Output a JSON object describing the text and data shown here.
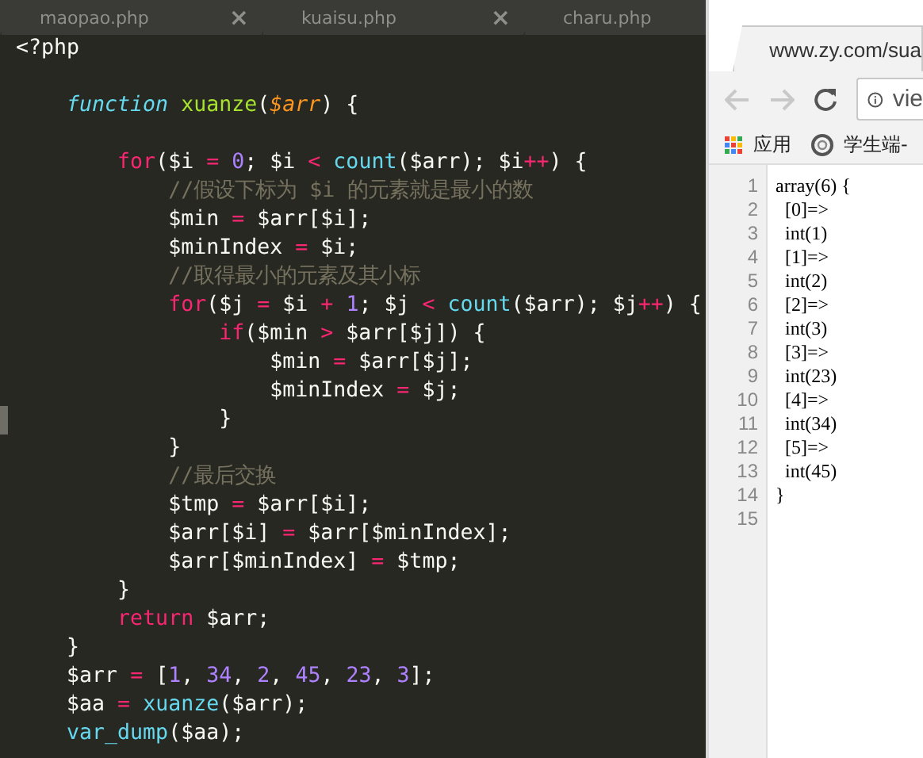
{
  "editor": {
    "tabs": [
      {
        "label": "maopao.php",
        "close": "×",
        "selected": false
      },
      {
        "label": "kuaisu.php",
        "close": "×",
        "selected": false
      },
      {
        "label": "charu.php",
        "selected": false
      }
    ],
    "lines": [
      {
        "kind": "code",
        "current": false,
        "tokens": [
          {
            "kind": "plain",
            "text": "<?php"
          }
        ]
      },
      {
        "kind": "blank",
        "current": false
      },
      {
        "kind": "code",
        "current": false,
        "tokens": [
          {
            "kind": "storage",
            "text": "    function"
          },
          {
            "kind": "entity",
            "text": " xuanze"
          },
          {
            "kind": "plain",
            "text": "("
          },
          {
            "kind": "param",
            "text": "$arr"
          },
          {
            "kind": "plain",
            "text": ") {"
          }
        ]
      },
      {
        "kind": "blank",
        "current": false
      },
      {
        "kind": "code",
        "current": false,
        "tokens": [
          {
            "kind": "keyword",
            "text": "        for"
          },
          {
            "kind": "plain",
            "text": "($i "
          },
          {
            "kind": "keyword",
            "text": "="
          },
          {
            "kind": "number",
            "text": " 0"
          },
          {
            "kind": "plain",
            "text": "; $i "
          },
          {
            "kind": "keyword",
            "text": "<"
          },
          {
            "kind": "builtin",
            "text": " count"
          },
          {
            "kind": "plain",
            "text": "($arr); $i"
          },
          {
            "kind": "keyword",
            "text": "++"
          },
          {
            "kind": "plain",
            "text": ") {"
          }
        ]
      },
      {
        "kind": "code",
        "current": false,
        "tokens": [
          {
            "kind": "comment",
            "text": "            //假设下标为 $i 的元素就是最小的数"
          }
        ]
      },
      {
        "kind": "code",
        "current": false,
        "tokens": [
          {
            "kind": "plain",
            "text": "            $min "
          },
          {
            "kind": "keyword",
            "text": "="
          },
          {
            "kind": "plain",
            "text": " $arr[$i];"
          }
        ]
      },
      {
        "kind": "code",
        "current": false,
        "tokens": [
          {
            "kind": "plain",
            "text": "            $minIndex "
          },
          {
            "kind": "keyword",
            "text": "="
          },
          {
            "kind": "plain",
            "text": " $i;"
          }
        ]
      },
      {
        "kind": "code",
        "current": false,
        "tokens": [
          {
            "kind": "comment",
            "text": "            //取得最小的元素及其小标"
          }
        ]
      },
      {
        "kind": "code",
        "current": false,
        "tokens": [
          {
            "kind": "keyword",
            "text": "            for"
          },
          {
            "kind": "plain",
            "text": "($j "
          },
          {
            "kind": "keyword",
            "text": "="
          },
          {
            "kind": "plain",
            "text": " $i "
          },
          {
            "kind": "keyword",
            "text": "+"
          },
          {
            "kind": "number",
            "text": " 1"
          },
          {
            "kind": "plain",
            "text": "; $j "
          },
          {
            "kind": "keyword",
            "text": "<"
          },
          {
            "kind": "builtin",
            "text": " count"
          },
          {
            "kind": "plain",
            "text": "($arr); $j"
          },
          {
            "kind": "keyword",
            "text": "++"
          },
          {
            "kind": "plain",
            "text": ") {"
          }
        ]
      },
      {
        "kind": "code",
        "current": false,
        "tokens": [
          {
            "kind": "keyword",
            "text": "                if"
          },
          {
            "kind": "plain",
            "text": "($min "
          },
          {
            "kind": "keyword",
            "text": ">"
          },
          {
            "kind": "plain",
            "text": " $arr[$j]) {"
          }
        ]
      },
      {
        "kind": "code",
        "current": false,
        "tokens": [
          {
            "kind": "plain",
            "text": "                    $min "
          },
          {
            "kind": "keyword",
            "text": "="
          },
          {
            "kind": "plain",
            "text": " $arr[$j];"
          }
        ]
      },
      {
        "kind": "code",
        "current": false,
        "tokens": [
          {
            "kind": "plain",
            "text": "                    $minIndex "
          },
          {
            "kind": "keyword",
            "text": "="
          },
          {
            "kind": "plain",
            "text": " $j;"
          }
        ]
      },
      {
        "kind": "code",
        "current": true,
        "tokens": [
          {
            "kind": "plain",
            "text": "                }"
          }
        ]
      },
      {
        "kind": "code",
        "current": false,
        "tokens": [
          {
            "kind": "plain",
            "text": "            }"
          }
        ]
      },
      {
        "kind": "code",
        "current": false,
        "tokens": [
          {
            "kind": "comment",
            "text": "            //最后交换"
          }
        ]
      },
      {
        "kind": "code",
        "current": false,
        "tokens": [
          {
            "kind": "plain",
            "text": "            $tmp "
          },
          {
            "kind": "keyword",
            "text": "="
          },
          {
            "kind": "plain",
            "text": " $arr[$i];"
          }
        ]
      },
      {
        "kind": "code",
        "current": false,
        "tokens": [
          {
            "kind": "plain",
            "text": "            $arr[$i] "
          },
          {
            "kind": "keyword",
            "text": "="
          },
          {
            "kind": "plain",
            "text": " $arr[$minIndex];"
          }
        ]
      },
      {
        "kind": "code",
        "current": false,
        "tokens": [
          {
            "kind": "plain",
            "text": "            $arr[$minIndex] "
          },
          {
            "kind": "keyword",
            "text": "="
          },
          {
            "kind": "plain",
            "text": " $tmp;"
          }
        ]
      },
      {
        "kind": "code",
        "current": false,
        "tokens": [
          {
            "kind": "plain",
            "text": "        }"
          }
        ]
      },
      {
        "kind": "code",
        "current": false,
        "tokens": [
          {
            "kind": "keyword",
            "text": "        return"
          },
          {
            "kind": "plain",
            "text": " $arr;"
          }
        ]
      },
      {
        "kind": "code",
        "current": false,
        "tokens": [
          {
            "kind": "plain",
            "text": "    }"
          }
        ]
      },
      {
        "kind": "code",
        "current": false,
        "tokens": [
          {
            "kind": "plain",
            "text": "    $arr "
          },
          {
            "kind": "keyword",
            "text": "="
          },
          {
            "kind": "plain",
            "text": " ["
          },
          {
            "kind": "number",
            "text": "1"
          },
          {
            "kind": "plain",
            "text": ", "
          },
          {
            "kind": "number",
            "text": "34"
          },
          {
            "kind": "plain",
            "text": ", "
          },
          {
            "kind": "number",
            "text": "2"
          },
          {
            "kind": "plain",
            "text": ", "
          },
          {
            "kind": "number",
            "text": "45"
          },
          {
            "kind": "plain",
            "text": ", "
          },
          {
            "kind": "number",
            "text": "23"
          },
          {
            "kind": "plain",
            "text": ", "
          },
          {
            "kind": "number",
            "text": "3"
          },
          {
            "kind": "plain",
            "text": "];"
          }
        ]
      },
      {
        "kind": "code",
        "current": false,
        "tokens": [
          {
            "kind": "plain",
            "text": "    $aa "
          },
          {
            "kind": "keyword",
            "text": "="
          },
          {
            "kind": "builtin",
            "text": " xuanze"
          },
          {
            "kind": "plain",
            "text": "($arr);"
          }
        ]
      },
      {
        "kind": "code",
        "current": false,
        "tokens": [
          {
            "kind": "builtin",
            "text": "    var_dump"
          },
          {
            "kind": "plain",
            "text": "($aa);"
          }
        ]
      }
    ]
  },
  "browser": {
    "tab": {
      "title": "www.zy.com/sua"
    },
    "address": {
      "value": "vie"
    },
    "bookmarks": [
      {
        "kind": "apps",
        "label": "应用"
      },
      {
        "kind": "site",
        "label": "学生端-"
      }
    ],
    "source_lines": [
      {
        "number": "1",
        "text": "array(6) {"
      },
      {
        "number": "2",
        "text": "  [0]=>"
      },
      {
        "number": "3",
        "text": "  int(1)"
      },
      {
        "number": "4",
        "text": "  [1]=>"
      },
      {
        "number": "5",
        "text": "  int(2)"
      },
      {
        "number": "6",
        "text": "  [2]=>"
      },
      {
        "number": "7",
        "text": "  int(3)"
      },
      {
        "number": "8",
        "text": "  [3]=>"
      },
      {
        "number": "9",
        "text": "  int(23)"
      },
      {
        "number": "10",
        "text": "  [4]=>"
      },
      {
        "number": "11",
        "text": "  int(34)"
      },
      {
        "number": "12",
        "text": "  [5]=>"
      },
      {
        "number": "13",
        "text": "  int(45)"
      },
      {
        "number": "14",
        "text": "}"
      },
      {
        "number": "15"
      }
    ]
  }
}
